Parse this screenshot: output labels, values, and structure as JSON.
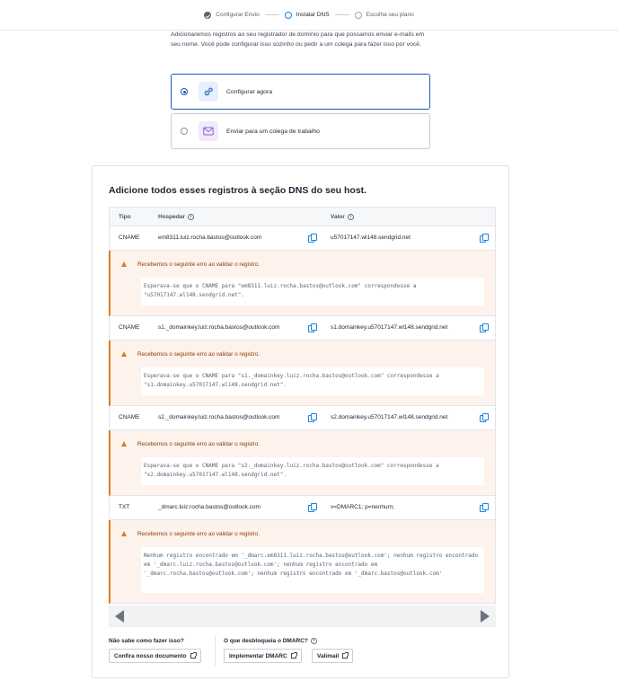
{
  "stepper": {
    "steps": [
      {
        "label": "Configurar Envio",
        "state": "done"
      },
      {
        "label": "Instalar DNS",
        "state": "active"
      },
      {
        "label": "Escolha seu plano",
        "state": "pending"
      }
    ]
  },
  "intro": "Adicionaremos registros ao seu registrador de domínio para que possamos enviar e-mails em seu nome. Você pode configurar isso sozinho ou pedir a um colega para fazer isso por você.",
  "options": [
    {
      "label": "Configurar agora",
      "selected": true
    },
    {
      "label": "Enviar para um colega de trabalho",
      "selected": false
    }
  ],
  "card": {
    "title": "Adicione todos esses registros à seção DNS do seu host.",
    "headers": {
      "type": "Tipo",
      "host": "Hospedar",
      "value": "Valor"
    },
    "records": [
      {
        "type": "CNAME",
        "host": "em8311.luiz.rocha.bastos@outlook.com",
        "value": "u57017147.wl148.sendgrid.net",
        "error_title": "Recebemos o seguinte erro ao validar o registro.",
        "error_detail": "Esperava-se que o CNAME para \"em8311.luiz.rocha.bastos@outlook.com\" correspondesse a \"u57017147.wl148.sendgrid.net\"."
      },
      {
        "type": "CNAME",
        "host": "s1._domainkey.luiz.rocha.bastos@outlook.com",
        "value": "s1.domainkey.u57017147.wl148.sendgrid.net",
        "error_title": "Recebemos o seguinte erro ao validar o registro.",
        "error_detail": "Esperava-se que o CNAME para \"s1._domainkey.luiz.rocha.bastos@outlook.com\" correspondesse a \"s1.domainkey.u57017147.wl148.sendgrid.net\"."
      },
      {
        "type": "CNAME",
        "host": "s2._domainkey.luiz.rocha.bastos@outlook.com",
        "value": "s2.domainkey.u57017147.wl148.sendgrid.net",
        "error_title": "Recebemos o seguinte erro ao validar o registro.",
        "error_detail": "Esperava-se que o CNAME para \"s2._domainkey.luiz.rocha.bastos@outlook.com\" correspondesse a \"s2.domainkey.u57017147.wl148.sendgrid.net\"."
      },
      {
        "type": "TXT",
        "host": "_dmarc.luiz.rocha.bastos@outlook.com",
        "value": "v=DMARC1; p=nenhum;",
        "error_title": "Recebemos o seguinte erro ao validar o registro.",
        "error_detail": "Nenhum registro encontrado em '_dmarc.em8311.luiz.rocha.bastos@outlook.com'; nenhum registro encontrado em '_dmarc.luiz.rocha.bastos@outlook.com'; nenhum registro encontrado em '_dmarc.rocha.bastos@outlook.com'; nenhum registro encontrado em '_dmarc.bastos@outlook.com'"
      }
    ]
  },
  "help": {
    "question_1": "Não sabe como fazer isso?",
    "question_2": "O que desbloqueia o DMARC?",
    "btn_docs": "Confira nosso documento",
    "btn_dmarc": "Implementar DMARC",
    "btn_valimail": "Valimail"
  }
}
